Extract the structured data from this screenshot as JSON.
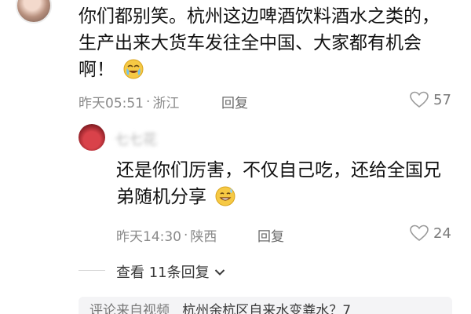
{
  "comment1": {
    "text": "你们都别笑。杭州这边啤酒饮料酒水之类的，生产出来大货车发往全中国、大家都有机会啊！",
    "emoji": "teary-laugh-emoji",
    "time": "昨天05:51",
    "location": "浙江",
    "reply_label": "回复",
    "likes": "57"
  },
  "comment2": {
    "author": "七七花",
    "text": "还是你们厉害，不仅自己吃，还给全国兄弟随机分享",
    "emoji": "grin-sweat-emoji",
    "time": "昨天14:30",
    "location": "陕西",
    "reply_label": "回复",
    "likes": "24"
  },
  "view_replies": {
    "label": "查看 11条回复"
  },
  "source": {
    "label": "评论来自视频",
    "title": "杭州余杭区自来水变粪水？7"
  },
  "colors": {
    "meta_gray": "#8a8a8a",
    "text": "#111111",
    "source_bg": "#f4f4f6"
  }
}
